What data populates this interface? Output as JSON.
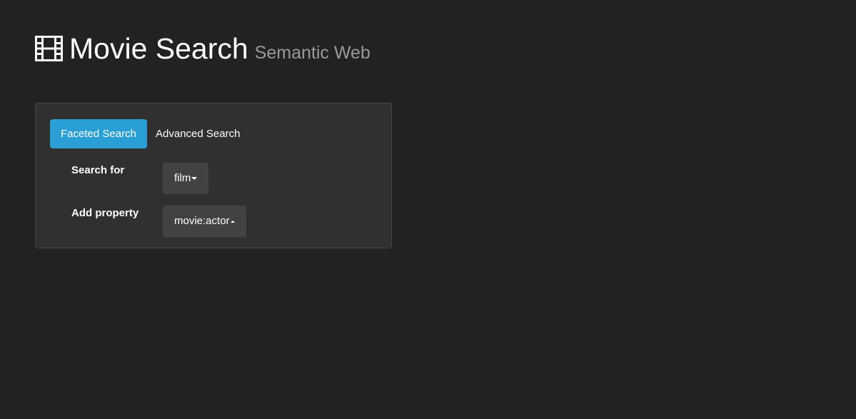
{
  "header": {
    "icon": "film-icon",
    "title": "Movie Search",
    "subtitle": "Semantic Web"
  },
  "tabs": [
    {
      "label": "Faceted Search",
      "active": true
    },
    {
      "label": "Advanced Search",
      "active": false
    }
  ],
  "form": {
    "search_for": {
      "label": "Search for",
      "selected": "film",
      "caret": "caret-down-icon"
    },
    "add_property": {
      "label": "Add property",
      "selected": "movie:actor",
      "caret": "caret-up-icon"
    }
  },
  "colors": {
    "background": "#222222",
    "panel": "#303030",
    "accent": "#2a9fd6",
    "dropdown": "#424242",
    "subtitle": "#999999"
  }
}
